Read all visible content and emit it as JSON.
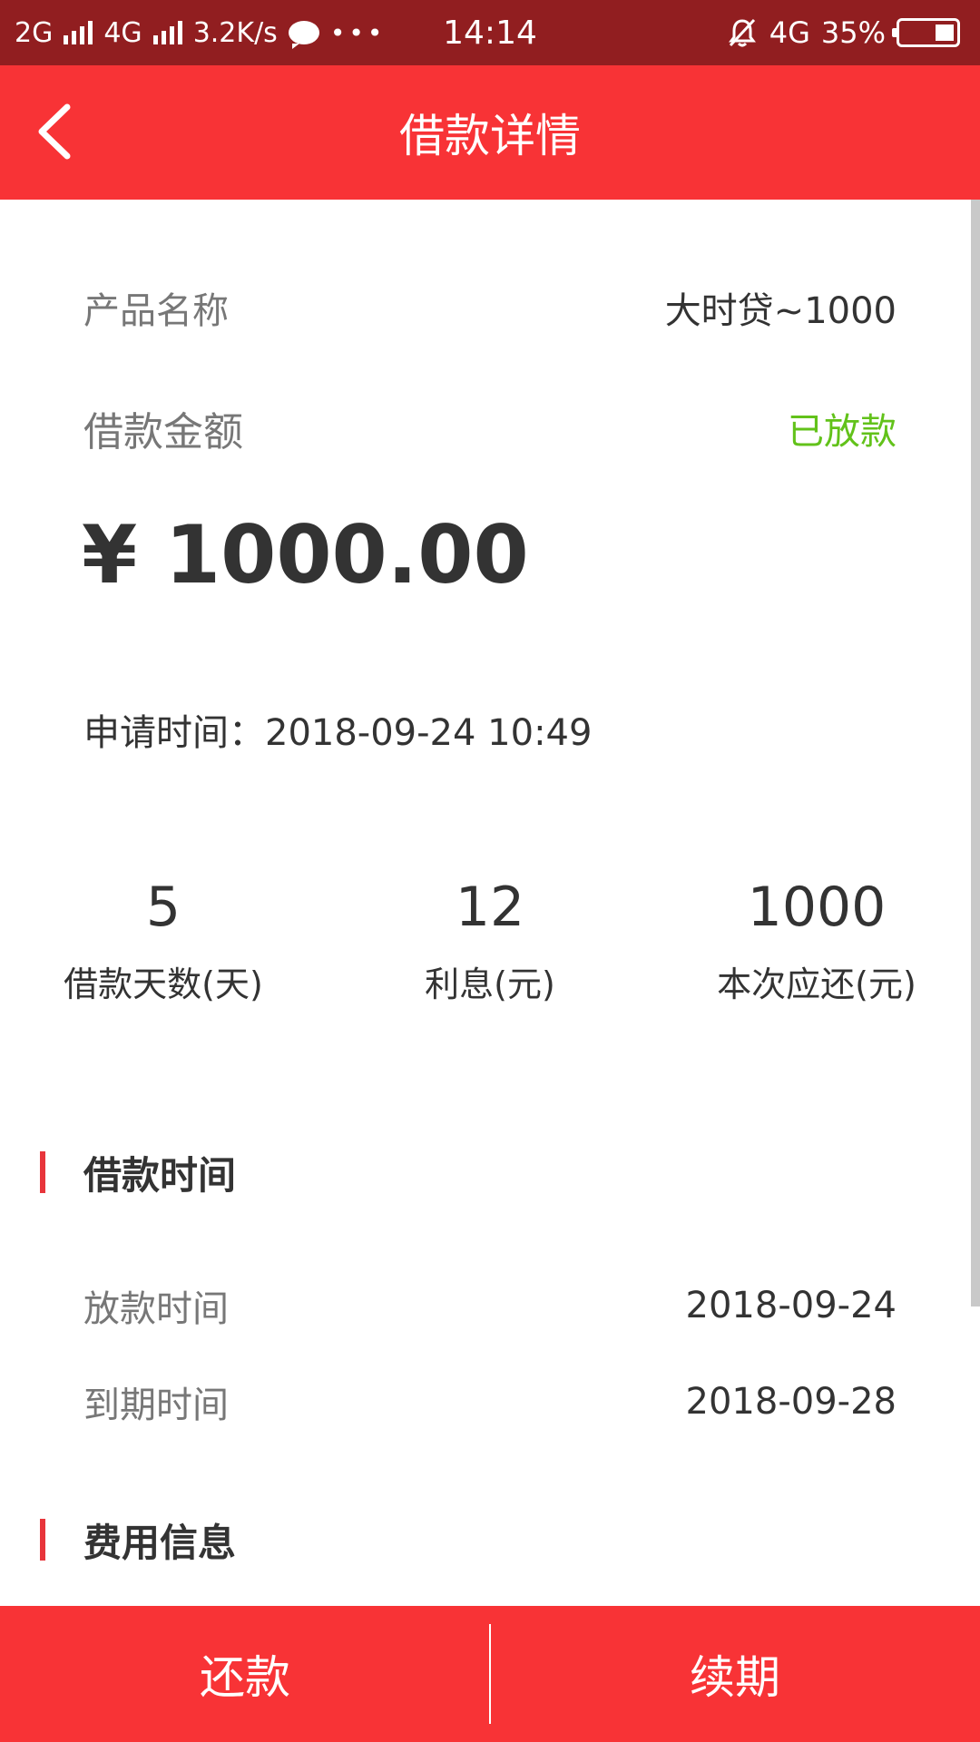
{
  "status_bar": {
    "network1": "2G",
    "network2": "4G",
    "speed": "3.2K/s",
    "more": "•••",
    "time": "14:14",
    "net_right": "4G",
    "battery": "35%"
  },
  "header": {
    "title": "借款详情"
  },
  "product": {
    "label": "产品名称",
    "value": "大时贷~1000"
  },
  "loan_amount": {
    "label": "借款金额",
    "status": "已放款",
    "amount": "¥ 1000.00"
  },
  "apply_time": {
    "text": "申请时间：2018-09-24 10:49"
  },
  "stats": [
    {
      "value": "5",
      "caption": "借款天数(天)"
    },
    {
      "value": "12",
      "caption": "利息(元)"
    },
    {
      "value": "1000",
      "caption": "本次应还(元)"
    }
  ],
  "loan_time_section": {
    "title": "借款时间",
    "rows": [
      {
        "label": "放款时间",
        "value": "2018-09-24"
      },
      {
        "label": "到期时间",
        "value": "2018-09-28"
      }
    ]
  },
  "fee_section": {
    "title": "费用信息"
  },
  "bottom": {
    "repay": "还款",
    "renew": "续期"
  },
  "colors": {
    "primary_red": "#f83336",
    "status_bar": "#911e20",
    "status_green": "#62c21a",
    "accent_bar": "#e8353b"
  }
}
